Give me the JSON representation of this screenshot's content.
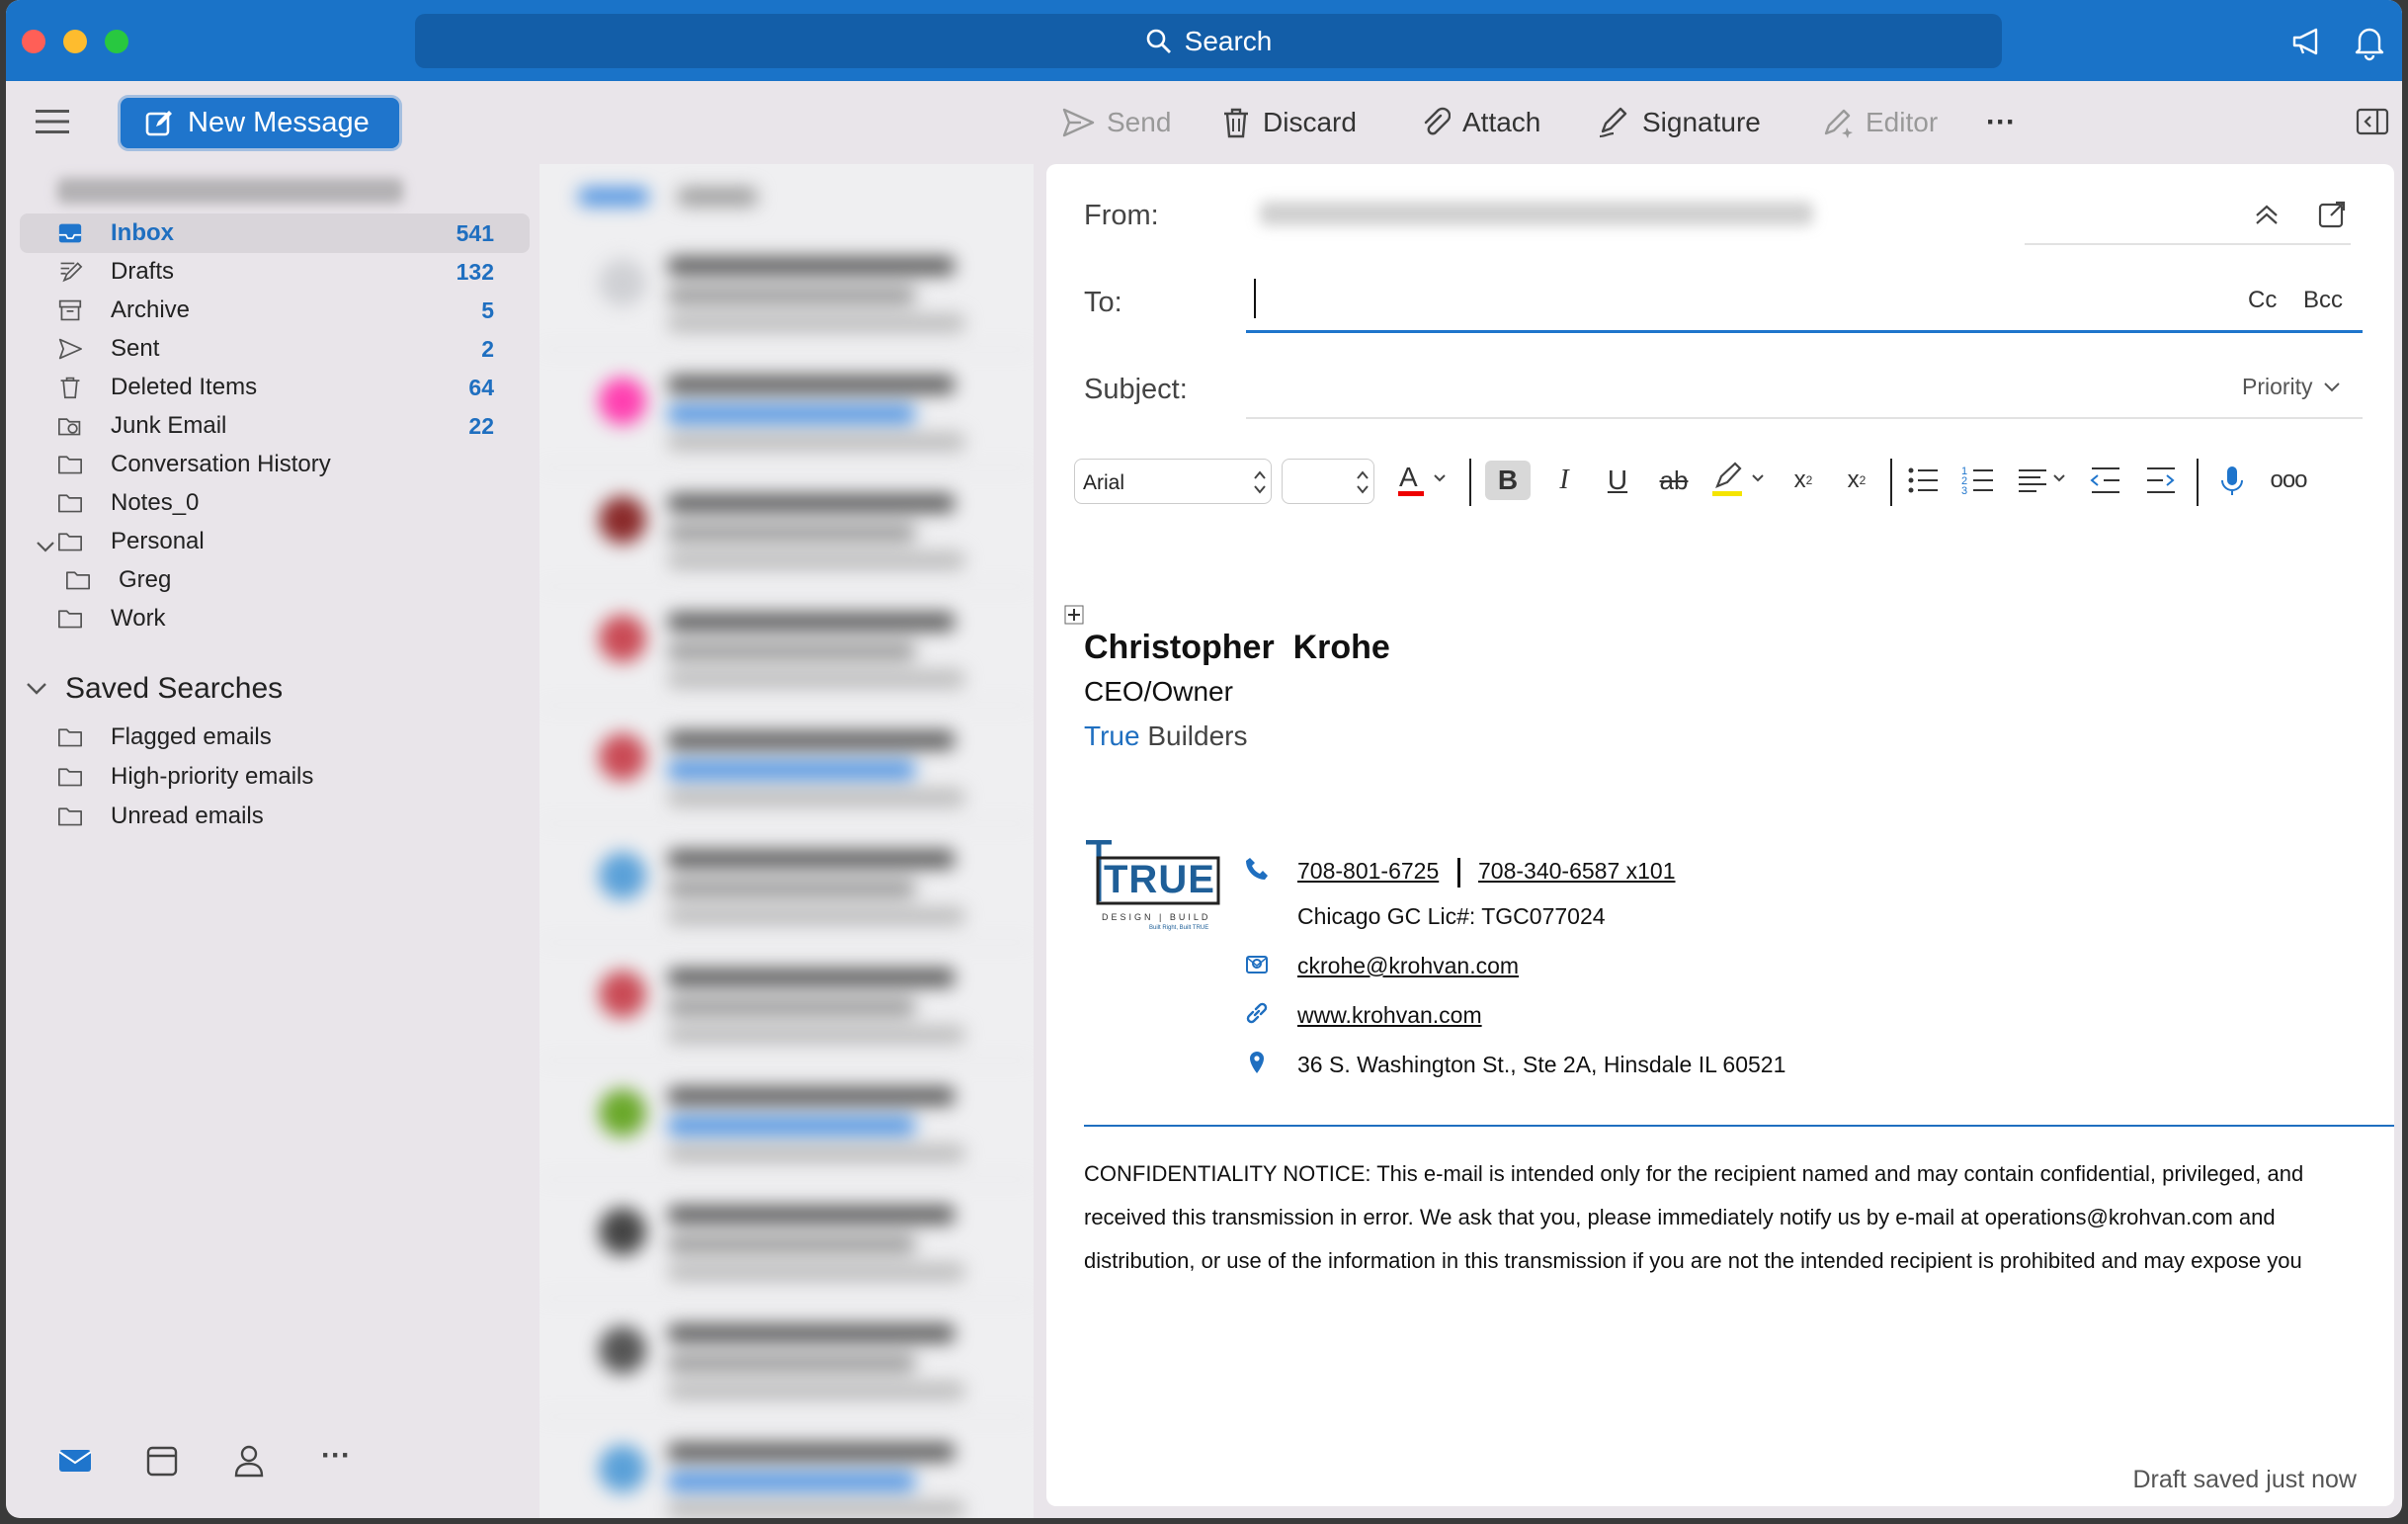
{
  "search": {
    "label": "Search"
  },
  "toolbar": {
    "new_message": "New Message",
    "send": "Send",
    "discard": "Discard",
    "attach": "Attach",
    "signature": "Signature",
    "editor": "Editor",
    "more": "···"
  },
  "sidebar": {
    "folders": [
      {
        "label": "Inbox",
        "count": "541"
      },
      {
        "label": "Drafts",
        "count": "132"
      },
      {
        "label": "Archive",
        "count": "5"
      },
      {
        "label": "Sent",
        "count": "2"
      },
      {
        "label": "Deleted Items",
        "count": "64"
      },
      {
        "label": "Junk Email",
        "count": "22"
      },
      {
        "label": "Conversation History",
        "count": ""
      },
      {
        "label": "Notes_0",
        "count": ""
      },
      {
        "label": "Personal",
        "count": ""
      },
      {
        "label": "Greg",
        "count": ""
      },
      {
        "label": "Work",
        "count": ""
      }
    ],
    "saved_searches_title": "Saved Searches",
    "saved_searches": [
      "Flagged emails",
      "High-priority emails",
      "Unread emails"
    ],
    "bottom_more": "···"
  },
  "compose": {
    "from_label": "From:",
    "to_label": "To:",
    "cc": "Cc",
    "bcc": "Bcc",
    "subject_label": "Subject:",
    "priority": "Priority",
    "font_name": "Arial",
    "signature": {
      "name": "Christopher  Krohe",
      "title": "CEO/Owner",
      "company_accent": "True",
      "company_rest": " Builders",
      "logo_text": "TRUE",
      "logo_sub": "DESIGN | BUILD",
      "logo_tag": "Built Right, Built TRUE",
      "phone1": "708-801-6725",
      "phone2": "708-340-6587 x101",
      "license": "Chicago GC Lic#: TGC077024",
      "email": "ckrohe@krohvan.com",
      "website": "www.krohvan.com",
      "address": "36 S. Washington St., Ste 2A, Hinsdale IL 60521"
    },
    "notice": [
      "CONFIDENTIALITY NOTICE: This e-mail is intended only for the recipient named and may contain confidential, privileged, and",
      "received this transmission in error. We ask that you, please immediately notify us by e-mail at operations@krohvan.com and",
      "distribution, or use of the information in this transmission if you are not the intended recipient is prohibited and may expose you"
    ],
    "draft_status": "Draft saved just now"
  },
  "colors": {
    "accent": "#1a73c8",
    "count": "#1f6fc0",
    "underline": "#1f6fc0",
    "logo_blue": "#1f5f98"
  }
}
